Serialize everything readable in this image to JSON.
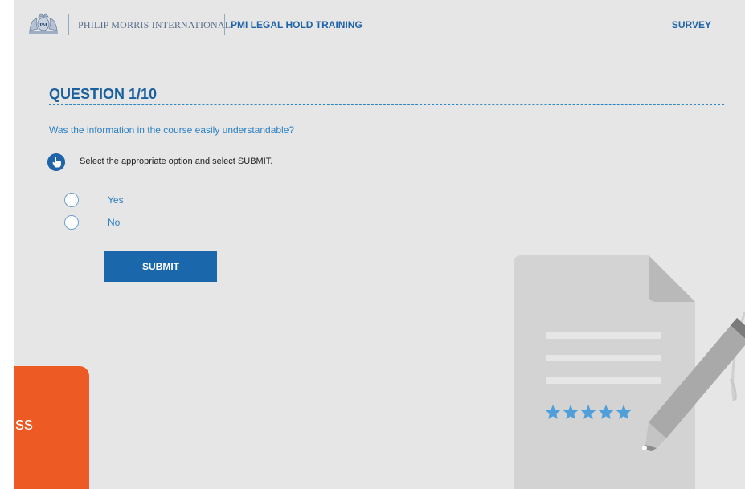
{
  "header": {
    "brand": "PHILIP MORRIS INTERNATIONAL",
    "course_title": "PMI LEGAL HOLD TRAINING",
    "section": "SURVEY"
  },
  "question": {
    "title": "QUESTION 1/10",
    "text": "Was the information in the course easily understandable?",
    "instruction": "Select the appropriate option and select SUBMIT.",
    "options": [
      {
        "label": "Yes",
        "selected": false
      },
      {
        "label": "No",
        "selected": false
      }
    ],
    "submit_label": "SUBMIT"
  },
  "overlay": {
    "partial_text": "ss"
  },
  "illustration": {
    "rating_stars": 5
  },
  "colors": {
    "background": "#e6e6e6",
    "primary_blue": "#1a67ac",
    "link_blue": "#2c80c4",
    "star_blue": "#4f9fda",
    "overlay_orange": "#ee5a24"
  }
}
